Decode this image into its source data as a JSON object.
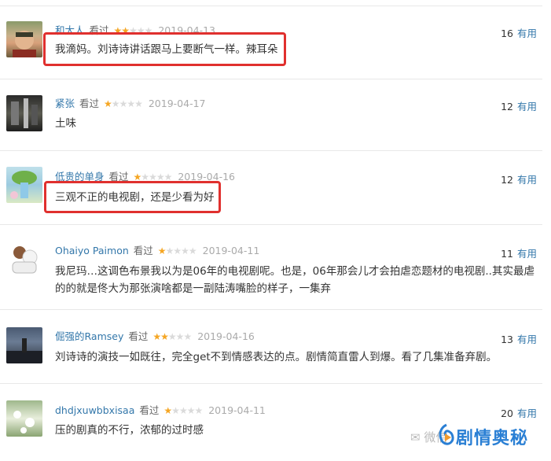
{
  "reviews": [
    {
      "user": "和大人",
      "watched": "看过",
      "rating": 2,
      "date": "2019-04-13",
      "useful_count": "16",
      "useful_label": "有用",
      "text": "我滴妈。刘诗诗讲话跟马上要断气一样。辣耳朵"
    },
    {
      "user": "紧张",
      "watched": "看过",
      "rating": 1,
      "date": "2019-04-17",
      "useful_count": "12",
      "useful_label": "有用",
      "text": "土味"
    },
    {
      "user": "低贵的单身",
      "watched": "看过",
      "rating": 1,
      "date": "2019-04-16",
      "useful_count": "12",
      "useful_label": "有用",
      "text": "三观不正的电视剧，还是少看为好"
    },
    {
      "user": "Ohaiyo Paimon",
      "watched": "看过",
      "rating": 1,
      "date": "2019-04-11",
      "useful_count": "11",
      "useful_label": "有用",
      "text": "我尼玛…这调色布景我以为是06年的电视剧呢。也是，06年那会儿才会拍虐恋题材的电视剧..其实最虐的的就是佟大为那张演啥都是一副陆涛嘴脸的样子，一集弃"
    },
    {
      "user": "倔强的Ramsey",
      "watched": "看过",
      "rating": 2,
      "date": "2019-04-16",
      "useful_count": "13",
      "useful_label": "有用",
      "text": "刘诗诗的演技一如既往，完全get不到情感表达的点。剧情简直雷人到爆。看了几集准备弃剧。"
    },
    {
      "user": "dhdjxuwbbxisaa",
      "watched": "看过",
      "rating": 1,
      "date": "2019-04-11",
      "useful_count": "20",
      "useful_label": "有用",
      "text": "压的剧真的不行，浓郁的过时感"
    }
  ],
  "watermark": {
    "prefix": "微信",
    "brand": "剧情奥秘"
  },
  "colors": {
    "link": "#3377aa",
    "star": "#f5a623",
    "highlight": "#e0302e",
    "watermark": "#2a7fd4"
  }
}
